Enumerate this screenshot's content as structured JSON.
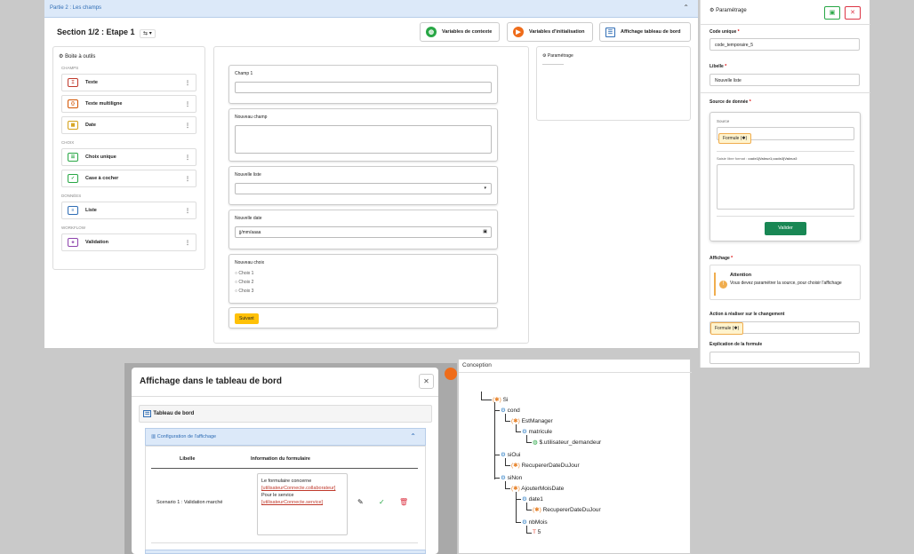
{
  "main": {
    "breadcrumb": "Partie 2 : Les champs",
    "section_title": "Section 1/2 : Etape 1",
    "section_selector_label": "⇆ ▾",
    "btn_context": "Variables de contexte",
    "btn_init": "Variables d'initialisation",
    "btn_dashboard": "Affichage tableau de bord",
    "toolbox_title": "Boite à outils",
    "cat_champs": "CHAMPS",
    "cat_choix": "CHOIX",
    "cat_donnees": "DONNÉES",
    "cat_workflow": "WORKFLOW",
    "tools": {
      "texte": "Texte",
      "texte_multi": "Texte multiligne",
      "date": "Date",
      "choix_unique": "Choix unique",
      "case": "Case à cocher",
      "liste": "Liste",
      "validation": "Validation"
    },
    "fields": {
      "champ1": "Champ 1",
      "nouveau_champ": "Nouveau champ",
      "nouvelle_liste": "Nouvelle liste",
      "nouvelle_date": "Nouvelle date",
      "date_placeholder": "jj/mm/aaaa",
      "nouveau_choix": "Nouveau choix",
      "choix1": "Choix 1",
      "choix2": "Choix 2",
      "choix3": "Choix 3"
    },
    "btn_suivant": "Suivant",
    "param_title": "Paramétrage"
  },
  "right": {
    "title": "Paramétrage",
    "code_label": "Code unique",
    "code_value": "code_temporaire_5",
    "libelle_label": "Libelle",
    "libelle_value": "Nouvelle liste",
    "source_label": "Source de donnée",
    "source_sub": "Source",
    "source_value": "Formule (✱)",
    "saisie_label": "Saisie libre format :",
    "saisie_format": "code1|Valeur1;code2|Valeur2",
    "valider": "Valider",
    "affichage_label": "Affichage",
    "attention_title": "Attention",
    "attention_text": "Vous devez paramétrer la source, pour choisir l'affichage",
    "action_label": "Action à réaliser sur le changement",
    "action_value": "Formule (✱)",
    "explication_label": "Explication de la formule",
    "required_mark": "*"
  },
  "dialog": {
    "title": "Affichage dans le tableau de bord",
    "tab_label": "Tableau de bord",
    "config_label": "Configuration de l'affichage",
    "col_libelle": "Libelle",
    "col_info": "Information du formulaire",
    "row_libelle": "Scenario 1 : Validation marché",
    "info_line1": "Le formulaire concerne",
    "info_link1": "[utilisateurConnecte.collaborateur]",
    "info_line2": "Pour le service",
    "info_link2": "[utilisateurConnecte.service]"
  },
  "conception": {
    "title": "Conception",
    "nodes": {
      "si": "Si",
      "cond": "cond",
      "estmanager": "EstManager",
      "matricule": "matricule",
      "user": "$.utilisateur_demandeur",
      "sioui": "siOui",
      "recup1": "RecupererDateDuJour",
      "sinon": "siNon",
      "ajouter": "AjouterMoisDate",
      "date1": "date1",
      "recup2": "RecupererDateDuJour",
      "nbmois": "nbMois",
      "five": "5"
    }
  }
}
